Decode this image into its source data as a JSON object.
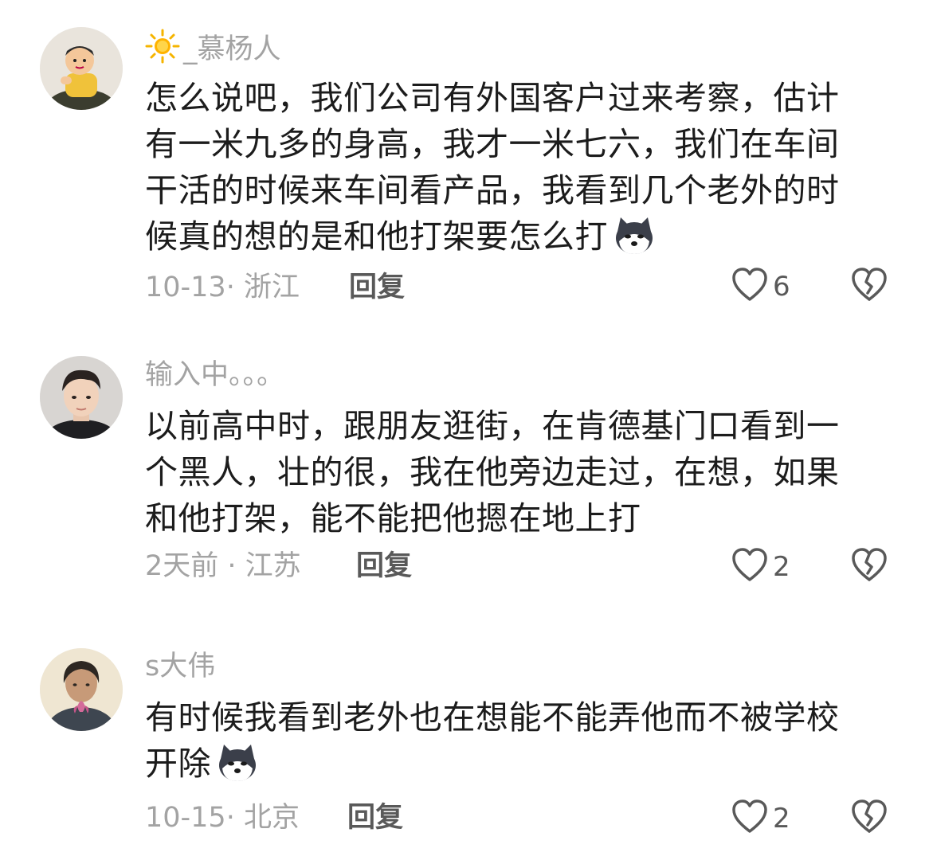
{
  "comments": [
    {
      "username": "_慕杨人",
      "text": "怎么说吧，我们公司有外国客户过来考察，估计有一米九多的身高，我才一米七六，我们在车间干活的时候来车间看产品，我看到几个老外的时候真的想的是和他打架要怎么打",
      "meta": "10-13· 浙江",
      "reply": "回复",
      "likes": "6"
    },
    {
      "username": "输入中。。。",
      "text": "以前高中时，跟朋友逛街，在肯德基门口看到一个黑人，壮的很，我在他旁边走过，在想，如果和他打架，能不能把他摁在地上打",
      "meta": "2天前 · 江苏",
      "reply": "回复",
      "likes": "2"
    },
    {
      "username": "s大伟",
      "text": "有时候我看到老外也在想能不能弄他而不被学校开除",
      "meta": "10-15· 北京",
      "reply": "回复",
      "likes": "2"
    }
  ],
  "icons": {
    "like": "heart-outline-icon",
    "dislike": "broken-heart-icon",
    "emoji": "husky-dog-emoji",
    "badge": "sun-icon"
  },
  "colors": {
    "username": "#a3a3a3",
    "text": "#1c1c1c",
    "action": "#595959"
  }
}
